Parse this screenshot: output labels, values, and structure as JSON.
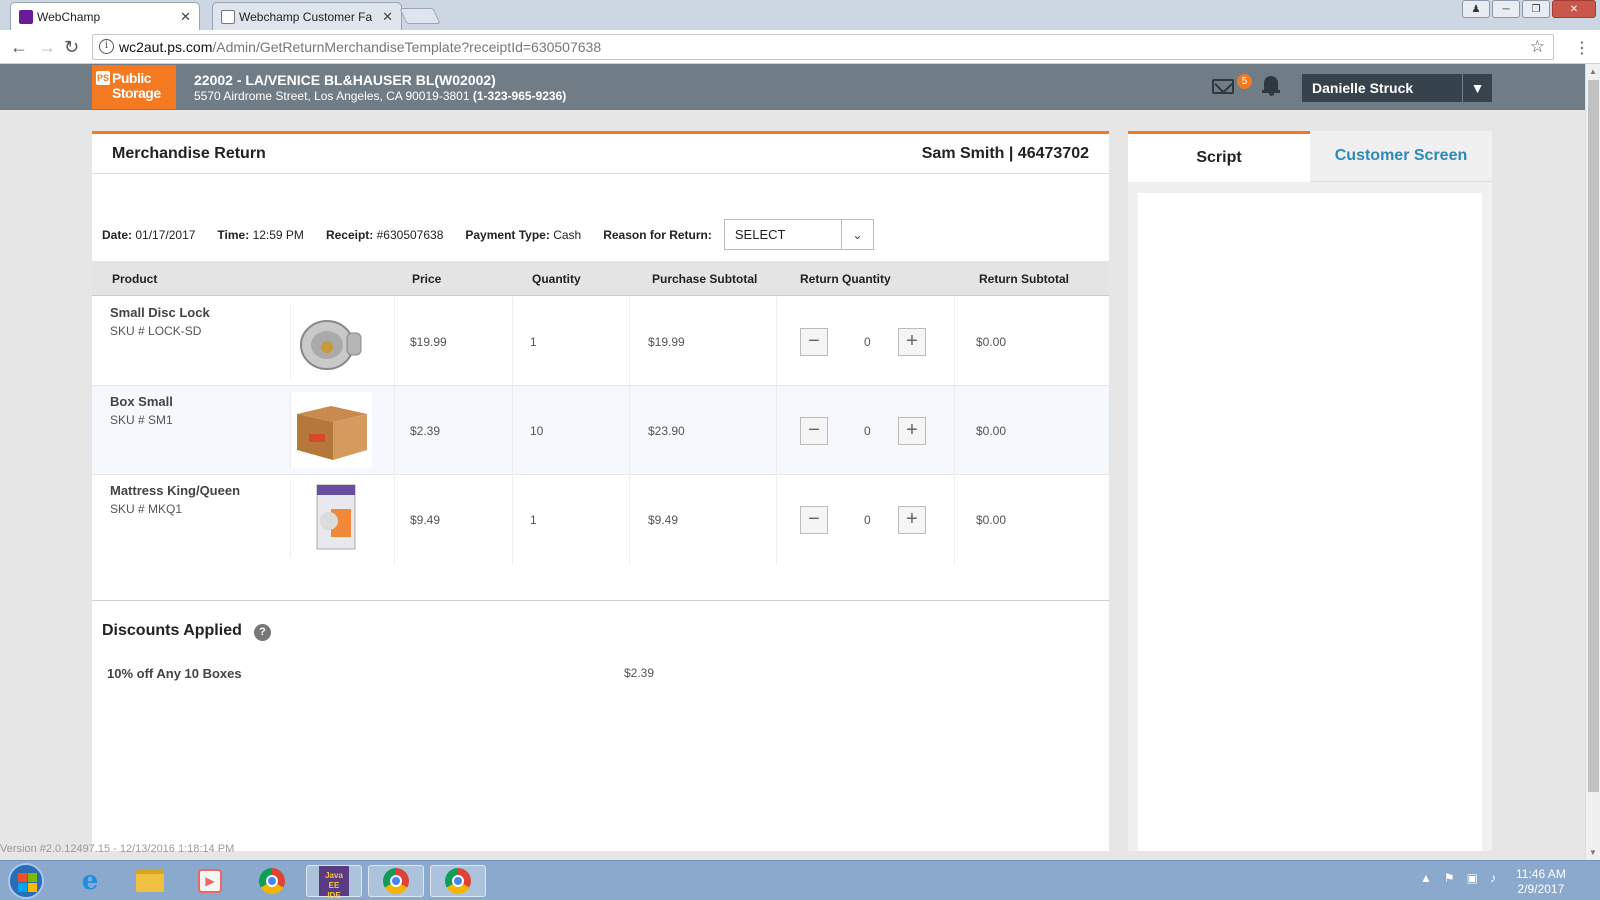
{
  "browser": {
    "tabs": [
      {
        "title": "WebChamp",
        "active": true
      },
      {
        "title": "Webchamp Customer Fa",
        "active": false
      }
    ],
    "url_host": "wc2aut.ps.com",
    "url_path": "/Admin/GetReturnMerchandiseTemplate?receiptId=630507638"
  },
  "header": {
    "logo_line1": "Public",
    "logo_line2": "Storage",
    "logo_badge": "PS",
    "store_name": "22002 - LA/VENICE BL&HAUSER BL(W02002)",
    "store_address": "5570 Airdrome Street, Los Angeles, CA 90019-3801",
    "store_phone": "(1-323-965-9236)",
    "mail_count": "5",
    "user_name": "Danielle Struck"
  },
  "main": {
    "title": "Merchandise Return",
    "customer": "Sam Smith | 46473702",
    "info": {
      "date_label": "Date:",
      "date": "01/17/2017",
      "time_label": "Time:",
      "time": "12:59 PM",
      "receipt_label": "Receipt:",
      "receipt": "#630507638",
      "payment_label": "Payment Type:",
      "payment": "Cash",
      "reason_label": "Reason for Return:",
      "reason_value": "SELECT"
    },
    "columns": {
      "product": "Product",
      "price": "Price",
      "quantity": "Quantity",
      "purchase_subtotal": "Purchase Subtotal",
      "return_quantity": "Return Quantity",
      "return_subtotal": "Return Subtotal"
    },
    "rows": [
      {
        "name": "Small Disc Lock",
        "sku": "SKU # LOCK-SD",
        "price": "$19.99",
        "qty": "1",
        "subtotal": "$19.99",
        "return_qty": "0",
        "return_subtotal": "$0.00"
      },
      {
        "name": "Box Small",
        "sku": "SKU # SM1",
        "price": "$2.39",
        "qty": "10",
        "subtotal": "$23.90",
        "return_qty": "0",
        "return_subtotal": "$0.00"
      },
      {
        "name": "Mattress King/Queen",
        "sku": "SKU # MKQ1",
        "price": "$9.49",
        "qty": "1",
        "subtotal": "$9.49",
        "return_qty": "0",
        "return_subtotal": "$0.00"
      }
    ],
    "discounts_title": "Discounts Applied",
    "discounts": [
      {
        "name": "10% off Any 10 Boxes",
        "amount": "$2.39"
      }
    ]
  },
  "side": {
    "tab_script": "Script",
    "tab_customer": "Customer Screen"
  },
  "footer": {
    "version": "Version #2.0.12497.15 - 12/13/2016 1:18:14 PM"
  },
  "taskbar": {
    "time": "11:46 AM",
    "date": "2/9/2017"
  },
  "colors": {
    "accent": "#f47920",
    "header_bg": "#707c86",
    "link": "#2b8ab8"
  }
}
